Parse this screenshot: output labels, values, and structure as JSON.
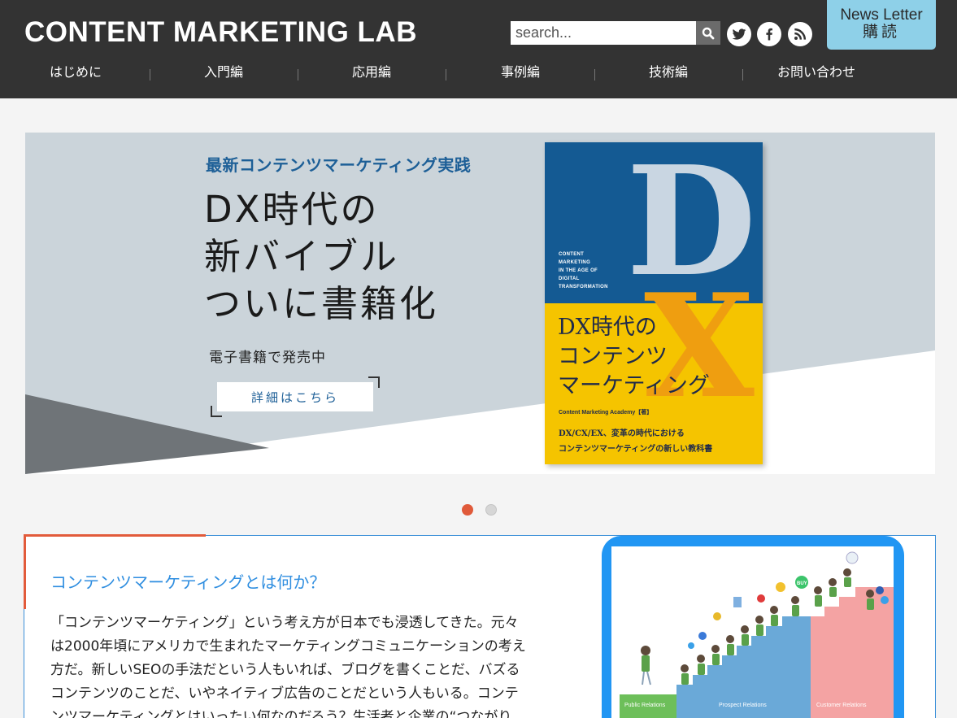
{
  "header": {
    "logo": "CONTENT MARKETING LAB",
    "search_placeholder": "search...",
    "social": [
      "twitter-icon",
      "facebook-icon",
      "rss-icon"
    ],
    "newsletter_line1": "News Letter",
    "newsletter_line2": "購読"
  },
  "nav": {
    "items": [
      {
        "label": "はじめに"
      },
      {
        "label": "入門編"
      },
      {
        "label": "応用編"
      },
      {
        "label": "事例編"
      },
      {
        "label": "技術編"
      },
      {
        "label": "お問い合わせ"
      }
    ]
  },
  "banner": {
    "kicker": "最新コンテンツマーケティング実践",
    "headline_1": "DX時代の",
    "headline_2": "新バイブル",
    "headline_3": "ついに書籍化",
    "sub": "電子書籍で発売中",
    "button": "詳細はこちら",
    "book": {
      "big_letter_1": "D",
      "big_letter_2": "X",
      "en_1": "CONTENT",
      "en_2": "MARKETING",
      "en_3": "IN THE AGE OF",
      "en_4": "DIGITAL",
      "en_5": "TRANSFORMATION",
      "title_1": "DX時代の",
      "title_2": "コンテンツ",
      "title_3": "マーケティング",
      "author": "Content Marketing Academy【著】",
      "desc_1": "DX/CX/EX、変革の時代における",
      "desc_2": "コンテンツマーケティングの新しい教科書"
    }
  },
  "carousel": {
    "active_index": 0,
    "count": 2
  },
  "article": {
    "title": "コンテンツマーケティングとは何か？",
    "line_1": "「コンテンツマーケティング」という考え方が日本でも浸透してきた。元々",
    "line_2": "は2000年頃にアメリカで生まれたマーケティングコミュニケーションの考え",
    "line_3": "方だ。新しいSEOの手法だという人もいれば、ブログを書くことだ、バズる",
    "line_4": "コンテンツのことだ、いやネイティブ広告のことだという人もいる。コンテ",
    "line_5": "ンツマーケティングとはいったい何なのだろう？生活者と企業の“つながり"
  },
  "illustration": {
    "label_1": "Public Relations",
    "label_2": "Prospect Relations",
    "label_3": "Customer Relations",
    "buy": "BUY"
  },
  "colors": {
    "header_bg": "#333333",
    "accent": "#e25b3b",
    "link_blue": "#2f8ee0",
    "newsletter": "#8ed0e8",
    "book_blue": "#145a93",
    "book_yellow": "#f5c400"
  }
}
